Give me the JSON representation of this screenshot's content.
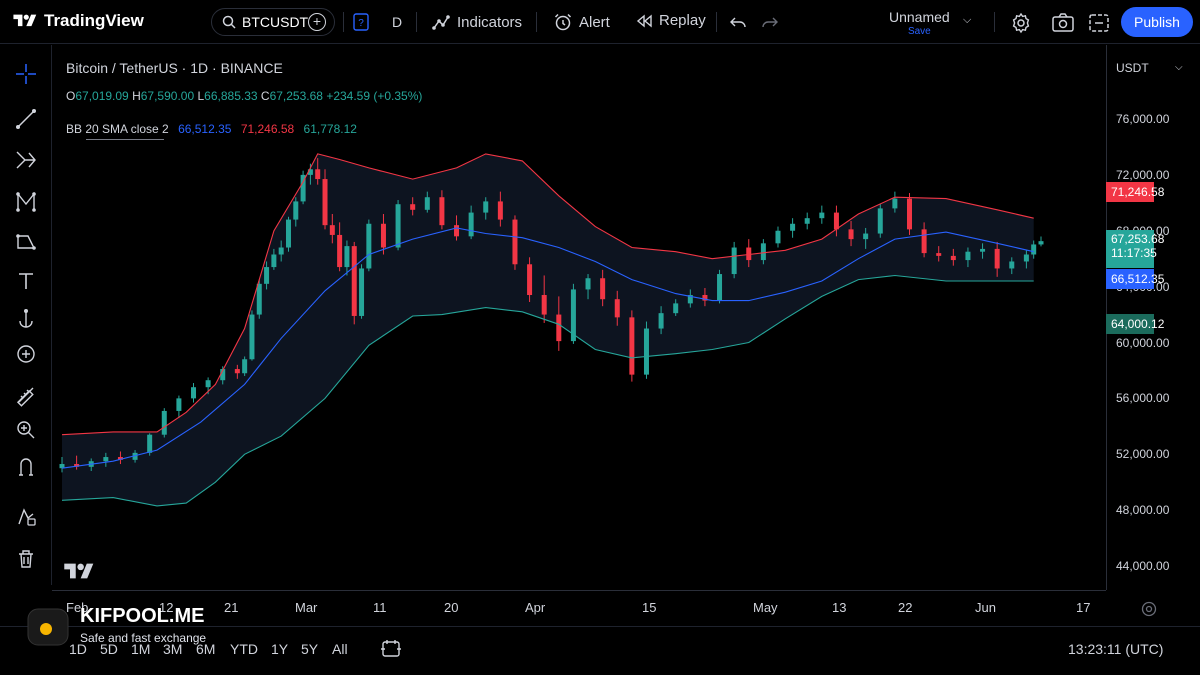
{
  "app": {
    "logo_text": "TradingView",
    "symbol": "BTCUSDT",
    "interval_button": "D",
    "indicators_label": "Indicators",
    "alert_label": "Alert",
    "replay_label": "Replay",
    "layout_name": "Unnamed",
    "save_label": "Save",
    "publish_label": "Publish"
  },
  "legend": {
    "title": "Bitcoin / TetherUS · 1D · BINANCE",
    "o_label": "O",
    "o_value": "67,019.09",
    "h_label": "H",
    "h_value": "67,590.00",
    "l_label": "L",
    "l_value": "66,885.33",
    "c_label": "C",
    "c_value": "67,253.68",
    "change": "+234.59 (+0.35%)",
    "indicator_name": "BB 20 SMA close 2",
    "bb_basis": "66,512.35",
    "bb_upper": "71,246.58",
    "bb_lower": "61,778.12"
  },
  "price_scale": {
    "currency": "USDT",
    "ticks": [
      "76,000.00",
      "72,000.00",
      "68,000.00",
      "64,000.00",
      "60,000.00",
      "56,000.00",
      "52,000.00",
      "48,000.00",
      "44,000.00"
    ],
    "upper_label": "71,246.58",
    "last_price_label": "67,253.68",
    "countdown_label": "11:17:35",
    "basis_label": "66,512.35",
    "crosshair_label": "64,000.12"
  },
  "time_scale": {
    "ticks": [
      "Feb",
      "12",
      "21",
      "Mar",
      "11",
      "20",
      "Apr",
      "15",
      "May",
      "13",
      "22",
      "Jun",
      "17"
    ]
  },
  "bottom": {
    "ranges": [
      "1D",
      "5D",
      "1M",
      "3M",
      "6M",
      "YTD",
      "1Y",
      "5Y",
      "All"
    ],
    "clock": "13:23:11 (UTC)"
  },
  "watermark": {
    "title": "KIFPOOL.ME",
    "subtitle": "Safe and fast exchange"
  },
  "colors": {
    "up": "#26a69a",
    "down": "#f23645",
    "basis": "#2962ff",
    "upper_band": "#f23645",
    "lower_band": "#26a69a",
    "band_fill": "#0d1420",
    "accent": "#2962ff"
  },
  "chart_data": {
    "type": "candlestick",
    "ylim": [
      43000,
      78500
    ],
    "ticks_y": [
      44000,
      48000,
      52000,
      56000,
      60000,
      64000,
      68000,
      72000,
      76000
    ],
    "bollinger": {
      "upper": [
        [
          "2024-02-01",
          53400
        ],
        [
          "2024-02-08",
          53600
        ],
        [
          "2024-02-14",
          53600
        ],
        [
          "2024-02-18",
          55000
        ],
        [
          "2024-02-22",
          57000
        ],
        [
          "2024-02-26",
          61000
        ],
        [
          "2024-03-01",
          68000
        ],
        [
          "2024-03-05",
          71500
        ],
        [
          "2024-03-07",
          73500
        ],
        [
          "2024-03-10",
          73100
        ],
        [
          "2024-03-14",
          72500
        ],
        [
          "2024-03-20",
          71700
        ],
        [
          "2024-03-26",
          72500
        ],
        [
          "2024-03-30",
          73500
        ],
        [
          "2024-04-04",
          73000
        ],
        [
          "2024-04-09",
          70500
        ],
        [
          "2024-04-14",
          68300
        ],
        [
          "2024-04-19",
          66800
        ],
        [
          "2024-04-25",
          66500
        ],
        [
          "2024-04-30",
          66000
        ],
        [
          "2024-05-05",
          66300
        ],
        [
          "2024-05-10",
          66600
        ],
        [
          "2024-05-15",
          67400
        ],
        [
          "2024-05-20",
          69200
        ],
        [
          "2024-05-25",
          70400
        ],
        [
          "2024-06-01",
          70300
        ],
        [
          "2024-06-08",
          69500
        ],
        [
          "2024-06-13",
          68900
        ]
      ],
      "basis": [
        [
          "2024-02-01",
          51000
        ],
        [
          "2024-02-08",
          51500
        ],
        [
          "2024-02-14",
          52300
        ],
        [
          "2024-02-20",
          54300
        ],
        [
          "2024-02-26",
          57000
        ],
        [
          "2024-03-02",
          60300
        ],
        [
          "2024-03-08",
          63700
        ],
        [
          "2024-03-14",
          66300
        ],
        [
          "2024-03-20",
          67400
        ],
        [
          "2024-03-26",
          68200
        ],
        [
          "2024-03-30",
          67800
        ],
        [
          "2024-04-04",
          67500
        ],
        [
          "2024-04-09",
          66800
        ],
        [
          "2024-04-14",
          65800
        ],
        [
          "2024-04-19",
          64500
        ],
        [
          "2024-04-25",
          63500
        ],
        [
          "2024-04-30",
          63000
        ],
        [
          "2024-05-05",
          63000
        ],
        [
          "2024-05-10",
          63600
        ],
        [
          "2024-05-15",
          64400
        ],
        [
          "2024-05-20",
          66000
        ],
        [
          "2024-05-25",
          67400
        ],
        [
          "2024-06-01",
          67900
        ],
        [
          "2024-06-08",
          67100
        ],
        [
          "2024-06-13",
          66500
        ]
      ],
      "lower": [
        [
          "2024-02-01",
          48700
        ],
        [
          "2024-02-08",
          48900
        ],
        [
          "2024-02-14",
          48300
        ],
        [
          "2024-02-18",
          48500
        ],
        [
          "2024-02-22",
          50000
        ],
        [
          "2024-02-26",
          52000
        ],
        [
          "2024-03-02",
          53300
        ],
        [
          "2024-03-08",
          56000
        ],
        [
          "2024-03-14",
          59800
        ],
        [
          "2024-03-20",
          61900
        ],
        [
          "2024-03-24",
          62000
        ],
        [
          "2024-03-30",
          62500
        ],
        [
          "2024-04-04",
          62200
        ],
        [
          "2024-04-09",
          61300
        ],
        [
          "2024-04-14",
          59500
        ],
        [
          "2024-04-19",
          58900
        ],
        [
          "2024-04-25",
          59200
        ],
        [
          "2024-04-30",
          59500
        ],
        [
          "2024-05-05",
          60000
        ],
        [
          "2024-05-10",
          61700
        ],
        [
          "2024-05-15",
          63300
        ],
        [
          "2024-05-20",
          64500
        ],
        [
          "2024-05-25",
          64800
        ],
        [
          "2024-06-01",
          64400
        ],
        [
          "2024-06-08",
          64400
        ],
        [
          "2024-06-13",
          64400
        ]
      ]
    },
    "candles": [
      [
        "2024-02-01",
        51000,
        51800,
        50700,
        51300
      ],
      [
        "2024-02-03",
        51300,
        51900,
        50900,
        51100
      ],
      [
        "2024-02-05",
        51100,
        51700,
        50800,
        51500
      ],
      [
        "2024-02-07",
        51500,
        52100,
        51100,
        51800
      ],
      [
        "2024-02-09",
        51800,
        52200,
        51300,
        51600
      ],
      [
        "2024-02-11",
        51600,
        52300,
        51400,
        52100
      ],
      [
        "2024-02-13",
        52100,
        53500,
        51900,
        53400
      ],
      [
        "2024-02-15",
        53400,
        55300,
        53200,
        55100
      ],
      [
        "2024-02-17",
        55100,
        56200,
        54600,
        56000
      ],
      [
        "2024-02-19",
        56000,
        57100,
        55700,
        56800
      ],
      [
        "2024-02-21",
        56800,
        57500,
        56300,
        57300
      ],
      [
        "2024-02-23",
        57300,
        58300,
        57000,
        58100
      ],
      [
        "2024-02-25",
        58100,
        58400,
        57400,
        57800
      ],
      [
        "2024-02-26",
        57800,
        59000,
        57600,
        58800
      ],
      [
        "2024-02-27",
        58800,
        62300,
        58700,
        62000
      ],
      [
        "2024-02-28",
        62000,
        64500,
        61700,
        64200
      ],
      [
        "2024-02-29",
        64200,
        65800,
        63800,
        65400
      ],
      [
        "2024-03-01",
        65400,
        66700,
        65200,
        66300
      ],
      [
        "2024-03-02",
        66300,
        67300,
        65800,
        66800
      ],
      [
        "2024-03-03",
        66800,
        69000,
        66500,
        68800
      ],
      [
        "2024-03-04",
        68800,
        70400,
        68300,
        70100
      ],
      [
        "2024-03-05",
        70100,
        72300,
        69900,
        72000
      ],
      [
        "2024-03-06",
        72000,
        72800,
        71300,
        72400
      ],
      [
        "2024-03-07",
        72400,
        73200,
        71300,
        71700
      ],
      [
        "2024-03-08",
        71700,
        72400,
        68100,
        68400
      ],
      [
        "2024-03-09",
        68400,
        69200,
        67100,
        67700
      ],
      [
        "2024-03-10",
        67700,
        68600,
        65100,
        65400
      ],
      [
        "2024-03-11",
        65400,
        67300,
        64800,
        66900
      ],
      [
        "2024-03-12",
        66900,
        67200,
        61300,
        61900
      ],
      [
        "2024-03-13",
        61900,
        65600,
        61700,
        65300
      ],
      [
        "2024-03-14",
        65300,
        68800,
        65100,
        68500
      ],
      [
        "2024-03-16",
        68500,
        69200,
        66300,
        66800
      ],
      [
        "2024-03-18",
        66800,
        70200,
        66600,
        69900
      ],
      [
        "2024-03-20",
        69900,
        70400,
        69100,
        69500
      ],
      [
        "2024-03-22",
        69500,
        70800,
        69300,
        70400
      ],
      [
        "2024-03-24",
        70400,
        70900,
        68100,
        68400
      ],
      [
        "2024-03-26",
        68400,
        69100,
        67300,
        67600
      ],
      [
        "2024-03-28",
        67600,
        69800,
        67400,
        69300
      ],
      [
        "2024-03-30",
        69300,
        70400,
        68800,
        70100
      ],
      [
        "2024-04-01",
        70100,
        70800,
        68300,
        68800
      ],
      [
        "2024-04-03",
        68800,
        69100,
        65200,
        65600
      ],
      [
        "2024-04-05",
        65600,
        66100,
        62900,
        63400
      ],
      [
        "2024-04-07",
        63400,
        64800,
        61400,
        62000
      ],
      [
        "2024-04-09",
        62000,
        63300,
        59400,
        60100
      ],
      [
        "2024-04-11",
        60100,
        64200,
        59900,
        63800
      ],
      [
        "2024-04-13",
        63800,
        64900,
        63100,
        64600
      ],
      [
        "2024-04-15",
        64600,
        65200,
        62600,
        63100
      ],
      [
        "2024-04-17",
        63100,
        63700,
        61200,
        61800
      ],
      [
        "2024-04-19",
        61800,
        62300,
        57200,
        57700
      ],
      [
        "2024-04-21",
        57700,
        61500,
        57400,
        61000
      ],
      [
        "2024-04-23",
        61000,
        62600,
        60600,
        62100
      ],
      [
        "2024-04-25",
        62100,
        63100,
        61900,
        62800
      ],
      [
        "2024-04-27",
        62800,
        63800,
        62500,
        63400
      ],
      [
        "2024-04-29",
        63400,
        63900,
        62600,
        63000
      ],
      [
        "2024-05-01",
        63000,
        65200,
        62800,
        64900
      ],
      [
        "2024-05-03",
        64900,
        67200,
        64600,
        66800
      ],
      [
        "2024-05-05",
        66800,
        67400,
        65400,
        65900
      ],
      [
        "2024-05-07",
        65900,
        67400,
        65600,
        67100
      ],
      [
        "2024-05-09",
        67100,
        68300,
        66800,
        68000
      ],
      [
        "2024-05-11",
        68000,
        68900,
        67500,
        68500
      ],
      [
        "2024-05-13",
        68500,
        69300,
        68100,
        68900
      ],
      [
        "2024-05-15",
        68900,
        69800,
        68500,
        69300
      ],
      [
        "2024-05-17",
        69300,
        69800,
        67600,
        68100
      ],
      [
        "2024-05-19",
        68100,
        68700,
        66900,
        67400
      ],
      [
        "2024-05-21",
        67400,
        68200,
        66700,
        67800
      ],
      [
        "2024-05-23",
        67800,
        69900,
        67500,
        69600
      ],
      [
        "2024-05-25",
        69600,
        70800,
        69300,
        70300
      ],
      [
        "2024-05-27",
        70300,
        70700,
        67700,
        68100
      ],
      [
        "2024-05-29",
        68100,
        68600,
        66100,
        66400
      ],
      [
        "2024-05-31",
        66400,
        66900,
        65800,
        66200
      ],
      [
        "2024-06-02",
        66200,
        66700,
        65500,
        65900
      ],
      [
        "2024-06-04",
        65900,
        66800,
        65400,
        66500
      ],
      [
        "2024-06-06",
        66500,
        67100,
        66000,
        66700
      ],
      [
        "2024-06-08",
        66700,
        67200,
        64700,
        65300
      ],
      [
        "2024-06-10",
        65300,
        66100,
        64900,
        65800
      ],
      [
        "2024-06-12",
        65800,
        66600,
        65300,
        66300
      ],
      [
        "2024-06-13",
        66300,
        67300,
        66000,
        67019
      ],
      [
        "2024-06-14",
        67019.09,
        67590.0,
        66885.33,
        67253.68
      ]
    ]
  }
}
